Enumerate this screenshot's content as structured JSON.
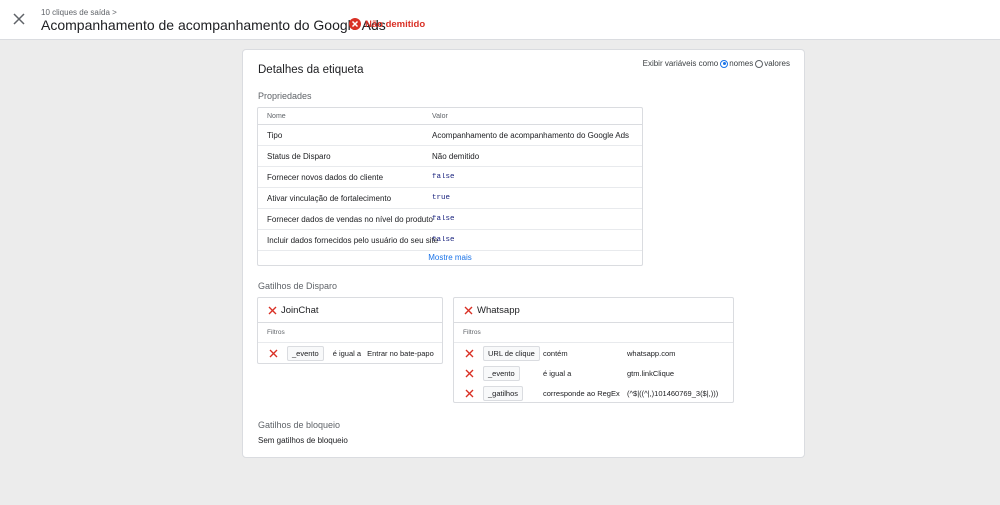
{
  "header": {
    "breadcrumb": "10 cliques de saída >",
    "title": "Acompanhamento de acompanhamento do Google Ads",
    "status": "Não demitido",
    "status_color": "#d93025"
  },
  "card": {
    "title": "Detalhes da etiqueta",
    "display_label": "Exibir variáveis como",
    "option_names": "nomes",
    "option_values": "valores",
    "selected_option": "nomes"
  },
  "properties": {
    "section_title": "Propriedades",
    "col_name": "Nome",
    "col_value": "Valor",
    "rows": [
      {
        "name": "Tipo",
        "value": "Acompanhamento de acompanhamento do Google Ads"
      },
      {
        "name": "Status de Disparo",
        "value": "Não demitido"
      },
      {
        "name": "Fornecer novos dados do cliente",
        "value": "false"
      },
      {
        "name": "Ativar vinculação de fortalecimento",
        "value": "true"
      },
      {
        "name": "Fornecer dados de vendas no nível do produto",
        "value": "false"
      },
      {
        "name": "Incluir dados fornecidos pelo usuário do seu site",
        "value": "false"
      }
    ],
    "show_more": "Mostre mais"
  },
  "firing_triggers": {
    "section_title": "Gatilhos de Disparo",
    "triggers": [
      {
        "name": "JoinChat",
        "filters_label": "Filtros",
        "filters": [
          {
            "variable": "_evento",
            "operator": "é igual a",
            "value": "Entrar no bate-papo"
          }
        ]
      },
      {
        "name": "Whatsapp",
        "filters_label": "Filtros",
        "filters": [
          {
            "variable": "URL de clique",
            "operator": "contém",
            "value": "whatsapp.com"
          },
          {
            "variable": "_evento",
            "operator": "é igual a",
            "value": "gtm.linkClique"
          },
          {
            "variable": "_gatilhos",
            "operator": "corresponde ao RegEx",
            "value": "(^$|((^|,)101460769_3($|,)))"
          }
        ]
      }
    ]
  },
  "blocking_triggers": {
    "section_title": "Gatilhos de bloqueio",
    "empty_text": "Sem gatilhos de bloqueio"
  }
}
